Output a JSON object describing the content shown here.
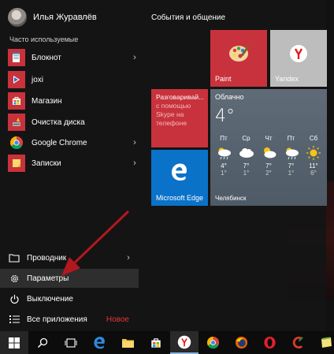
{
  "user": {
    "name": "Илья Журавлёв"
  },
  "most_used": {
    "label": "Часто используемые",
    "items": [
      {
        "label": "Блокнот",
        "icon": "notepad-icon",
        "color": "#c8323c",
        "has_submenu": true
      },
      {
        "label": "joxi",
        "icon": "joxi-icon",
        "color": "#c8323c",
        "has_submenu": false
      },
      {
        "label": "Магазин",
        "icon": "store-icon",
        "color": "#c8323c",
        "has_submenu": false
      },
      {
        "label": "Очистка диска",
        "icon": "disk-cleanup-icon",
        "color": "#c8323c",
        "has_submenu": false
      },
      {
        "label": "Google Chrome",
        "icon": "chrome-icon",
        "color": "#c8323c",
        "has_submenu": true
      },
      {
        "label": "Записки",
        "icon": "sticky-notes-icon",
        "color": "#c8323c",
        "has_submenu": true
      }
    ]
  },
  "bottom": {
    "explorer": "Проводник",
    "settings": "Параметры",
    "power": "Выключение",
    "all_apps": "Все приложения",
    "new_badge": "Новое"
  },
  "tiles": {
    "group_title": "События и общение",
    "paint": "Paint",
    "yandex": "Yandex",
    "skype": {
      "line1": "Разговаривай...",
      "line2": "с помощью",
      "line3": "Skype на",
      "line4": "телефоне"
    },
    "edge": "Microsoft Edge",
    "weather": {
      "title": "Облачно",
      "temp": "4°",
      "city": "Челябинск",
      "days": [
        {
          "name": "Пт",
          "hi": "4°",
          "lo": "1°",
          "icon": "sun-cloud-rain"
        },
        {
          "name": "Ср",
          "hi": "7°",
          "lo": "1°",
          "icon": "cloud"
        },
        {
          "name": "Чт",
          "hi": "7°",
          "lo": "2°",
          "icon": "sun-cloud"
        },
        {
          "name": "Пт",
          "hi": "7°",
          "lo": "1°",
          "icon": "sun-cloud-rain"
        },
        {
          "name": "Сб",
          "hi": "11°",
          "lo": "6°",
          "icon": "sun"
        }
      ]
    }
  },
  "colors": {
    "accent": "#c8323c",
    "edge": "#0a72c8",
    "yandex_tile": "#bdbdbd",
    "weather": "#56626e"
  },
  "taskbar": [
    "windows-logo-icon",
    "search-icon",
    "task-view-icon",
    "edge-icon",
    "file-explorer-icon",
    "store-icon",
    "yandex-icon",
    "chrome-icon",
    "firefox-icon",
    "opera-icon",
    "ccleaner-icon",
    "notepad-icon"
  ]
}
